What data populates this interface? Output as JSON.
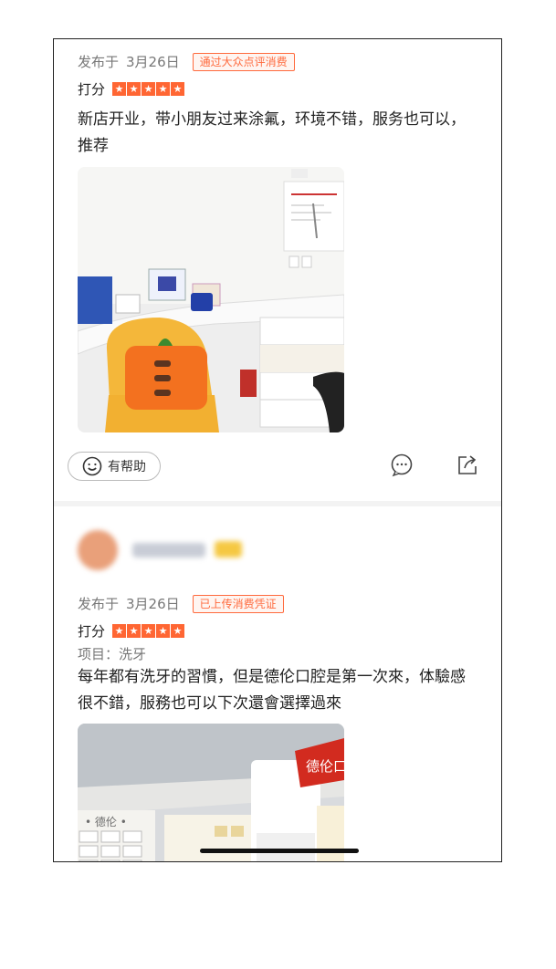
{
  "reviews": [
    {
      "published_prefix": "发布于",
      "date": "3月26日",
      "badge": "通过大众点评消费",
      "rating_label": "打分",
      "stars": 5,
      "text": "新店开业，带小朋友过来涂氟，环境不错，服务也可以，推荐"
    },
    {
      "published_prefix": "发布于",
      "date": "3月26日",
      "badge": "已上传消费凭证",
      "rating_label": "打分",
      "stars": 5,
      "item": "项目：洗牙",
      "text": "每年都有洗牙的習慣，但是德伦口腔是第一次來，体驗感很不錯，服務也可以下次還會選擇過來"
    }
  ],
  "actions": {
    "helpful_label": "有帮助",
    "comment_icon": "comment-bubble-icon",
    "share_icon": "share-icon"
  },
  "photo2_banner": "德伦口",
  "photo2_wall_text": "• 德伦 •",
  "colors": {
    "accent": "#ff6633",
    "badge_border": "#ff6a3d",
    "meta_gray": "#777777"
  }
}
